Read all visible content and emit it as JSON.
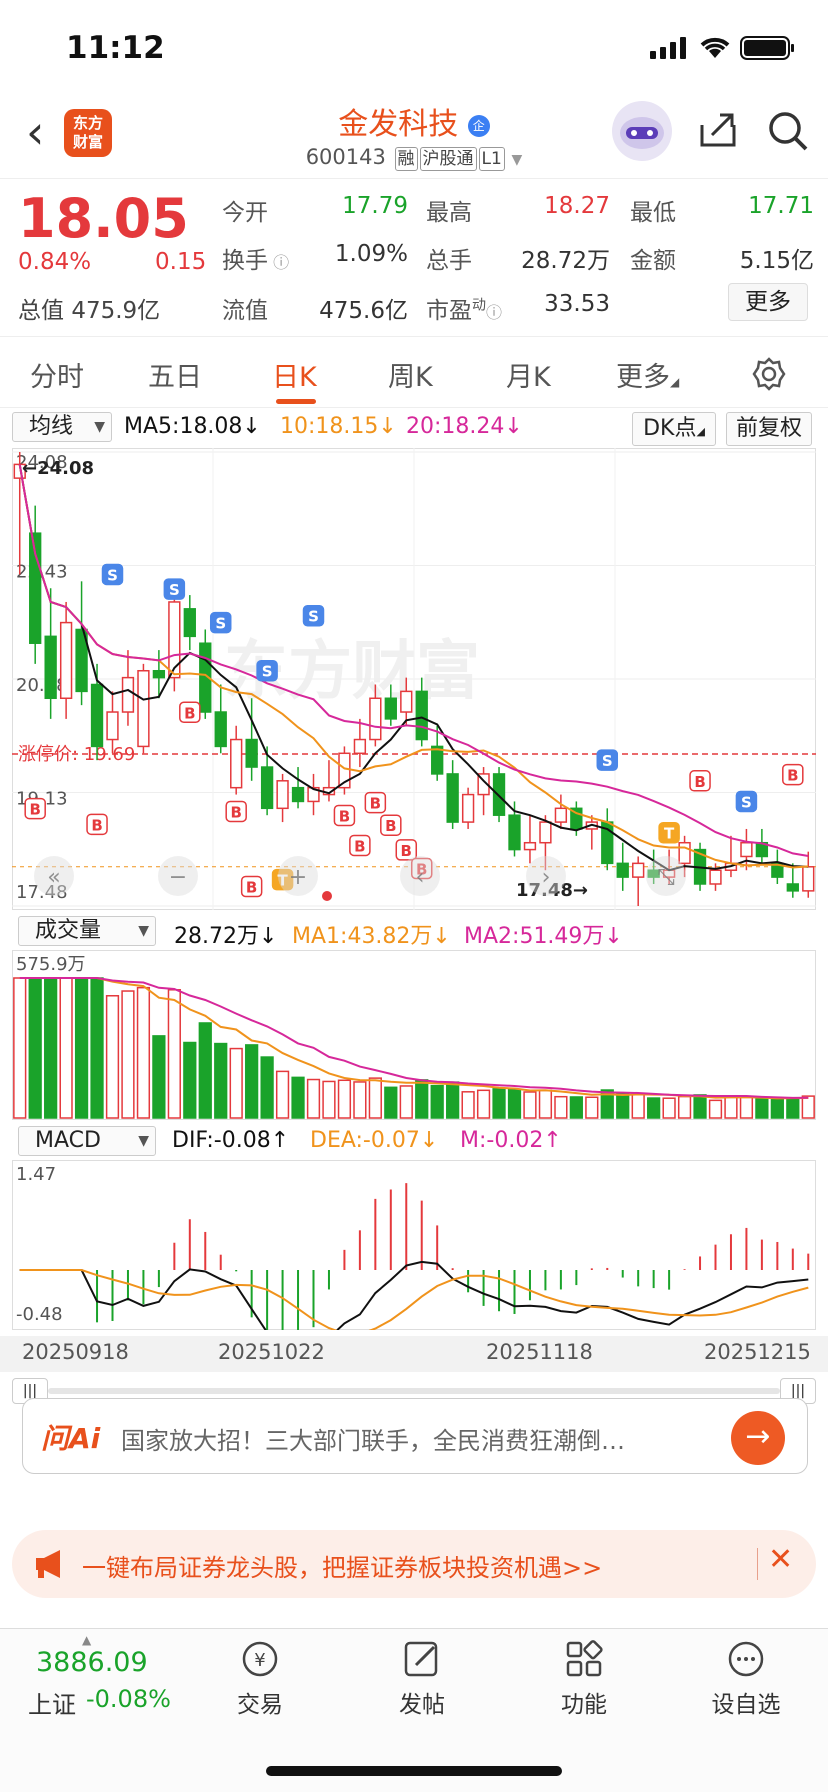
{
  "status": {
    "time": "11:12"
  },
  "nav": {
    "back": "‹",
    "logo_line1": "东方",
    "logo_line2": "财富",
    "name": "金发科技",
    "name_badge": "企",
    "code": "600143",
    "tags": [
      "融",
      "沪股通",
      "L1"
    ]
  },
  "quote": {
    "price": "18.05",
    "pct": "0.84%",
    "change": "0.15",
    "total_mv_label": "总值",
    "total_mv": "475.9亿",
    "open_label": "今开",
    "open": "17.79",
    "high_label": "最高",
    "high": "18.27",
    "low_label": "最低",
    "low": "17.71",
    "turnover_label": "换手",
    "turnover": "1.09%",
    "volume_label": "总手",
    "volume": "28.72万",
    "amount_label": "金额",
    "amount": "5.15亿",
    "float_mv_label": "流值",
    "float_mv": "475.6亿",
    "pe_label": "市盈",
    "pe_sup": "动",
    "pe": "33.53",
    "more": "更多"
  },
  "tabs": [
    "分时",
    "五日",
    "日K",
    "周K",
    "月K",
    "更多"
  ],
  "active_tab": "日K",
  "kline_bar": {
    "indicator": "均线",
    "ma5": "MA5:18.08↓",
    "ma10": "10:18.15↓",
    "ma20": "20:18.24↓",
    "dk": "DK点",
    "adjust": "前复权"
  },
  "kline": {
    "y_labels": [
      "24.08",
      "22.43",
      "20.78",
      "19.13",
      "17.48"
    ],
    "max_marker": "←24.08",
    "min_marker": "17.48→",
    "limit_label": "涨停价: 19.69",
    "watermark": "东方财富"
  },
  "volume_bar": {
    "indicator": "成交量",
    "vol": "28.72万↓",
    "ma1": "MA1:43.82万↓",
    "ma2": "MA2:51.49万↓",
    "max": "575.9万"
  },
  "macd_bar": {
    "indicator": "MACD",
    "dif": "DIF:-0.08↑",
    "dea": "DEA:-0.07↓",
    "m": "M:-0.02↑",
    "top": "1.47",
    "bottom": "-0.48"
  },
  "dates": [
    "20250918",
    "20251022",
    "20251118",
    "20251215"
  ],
  "ai": {
    "logo": "问Ai",
    "text": "国家放大招！三大部门联手，全民消费狂潮倒…",
    "go": "→"
  },
  "promo": {
    "text": "一键布局证券龙头股，把握证券板块投资机遇>>",
    "close": "✕"
  },
  "bottom": {
    "index_value": "3886.09",
    "index_label": "上证",
    "index_change": "-0.08%",
    "items": [
      "交易",
      "发帖",
      "功能",
      "设自选"
    ]
  },
  "colors": {
    "up": "#e4393c",
    "down": "#1aa32a",
    "accent": "#e8501c",
    "ma5": "#111111",
    "ma10": "#f0931c",
    "ma20": "#d6289a"
  },
  "chart_data": {
    "type": "candlestick",
    "ylim": [
      17.48,
      24.08
    ],
    "candles": [
      [
        23.7,
        24.08,
        22.3,
        23.9
      ],
      [
        22.9,
        23.3,
        21.0,
        21.3
      ],
      [
        21.4,
        22.1,
        20.2,
        20.5
      ],
      [
        20.5,
        21.9,
        20.2,
        21.6
      ],
      [
        21.5,
        22.2,
        20.4,
        20.6
      ],
      [
        20.7,
        21.0,
        19.6,
        19.8
      ],
      [
        19.9,
        20.6,
        19.7,
        20.3
      ],
      [
        20.3,
        21.2,
        20.1,
        20.8
      ],
      [
        19.8,
        21.0,
        19.7,
        20.9
      ],
      [
        20.9,
        21.2,
        20.5,
        20.8
      ],
      [
        20.8,
        22.2,
        20.6,
        21.9
      ],
      [
        21.8,
        22.0,
        21.2,
        21.4
      ],
      [
        21.3,
        21.5,
        20.2,
        20.3
      ],
      [
        20.3,
        20.7,
        19.7,
        19.8
      ],
      [
        19.2,
        20.1,
        19.1,
        19.9
      ],
      [
        19.9,
        20.5,
        19.3,
        19.5
      ],
      [
        19.5,
        19.8,
        18.8,
        18.9
      ],
      [
        18.9,
        19.4,
        18.7,
        19.3
      ],
      [
        19.2,
        19.5,
        18.9,
        19.0
      ],
      [
        19.0,
        19.4,
        18.8,
        19.2
      ],
      [
        19.1,
        19.6,
        19.0,
        19.2
      ],
      [
        19.2,
        19.8,
        19.1,
        19.7
      ],
      [
        19.7,
        20.2,
        19.5,
        19.9
      ],
      [
        19.9,
        20.7,
        19.8,
        20.5
      ],
      [
        20.5,
        20.7,
        20.1,
        20.2
      ],
      [
        20.3,
        20.8,
        20.1,
        20.6
      ],
      [
        20.6,
        20.8,
        19.8,
        19.9
      ],
      [
        19.8,
        20.1,
        19.3,
        19.4
      ],
      [
        19.4,
        19.6,
        18.6,
        18.7
      ],
      [
        18.7,
        19.2,
        18.6,
        19.1
      ],
      [
        19.1,
        19.5,
        18.8,
        19.4
      ],
      [
        19.4,
        19.5,
        18.7,
        18.8
      ],
      [
        18.8,
        19.0,
        18.2,
        18.3
      ],
      [
        18.3,
        18.8,
        18.1,
        18.4
      ],
      [
        18.4,
        18.8,
        18.0,
        18.7
      ],
      [
        18.7,
        19.1,
        18.6,
        18.9
      ],
      [
        18.9,
        19.0,
        18.5,
        18.6
      ],
      [
        18.6,
        18.8,
        18.3,
        18.7
      ],
      [
        18.7,
        18.9,
        18.0,
        18.1
      ],
      [
        18.1,
        18.4,
        17.7,
        17.9
      ],
      [
        17.9,
        18.2,
        17.48,
        18.1
      ],
      [
        18.0,
        18.3,
        17.8,
        17.9
      ],
      [
        17.9,
        18.3,
        17.8,
        18.0
      ],
      [
        18.1,
        18.5,
        17.9,
        18.4
      ],
      [
        18.3,
        18.4,
        17.7,
        17.8
      ],
      [
        17.8,
        18.1,
        17.7,
        18.0
      ],
      [
        18.0,
        18.5,
        17.9,
        18.1
      ],
      [
        18.2,
        18.6,
        18.0,
        18.4
      ],
      [
        18.4,
        18.6,
        18.1,
        18.2
      ],
      [
        18.1,
        18.3,
        17.8,
        17.9
      ],
      [
        17.8,
        18.1,
        17.6,
        17.7
      ],
      [
        17.7,
        18.27,
        17.6,
        18.05
      ]
    ],
    "volume_max": "575.9万",
    "dates": [
      "20250918",
      "20251022",
      "20251118",
      "20251215"
    ]
  }
}
